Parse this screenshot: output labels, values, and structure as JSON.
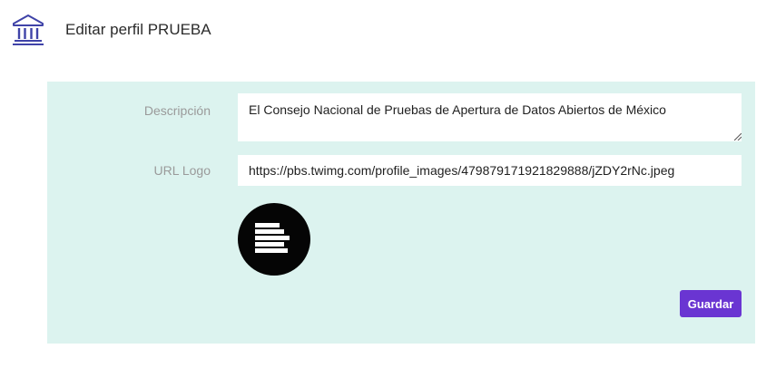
{
  "header": {
    "icon": "institution-icon",
    "title": "Editar perfil PRUEBA"
  },
  "form": {
    "description": {
      "label": "Descripción",
      "value": "El Consejo Nacional de Pruebas de Apertura de Datos Abiertos de México"
    },
    "logo_url": {
      "label": "URL Logo",
      "value": "https://pbs.twimg.com/profile_images/479879171921829888/jZDY2rNc.jpeg"
    },
    "logo_preview": {
      "icon": "logo-bars-icon"
    },
    "save_label": "Guardar"
  },
  "colors": {
    "accent": "#6a35d2",
    "panel_background": "#dcf3ef",
    "icon_color": "#3f43a8"
  }
}
